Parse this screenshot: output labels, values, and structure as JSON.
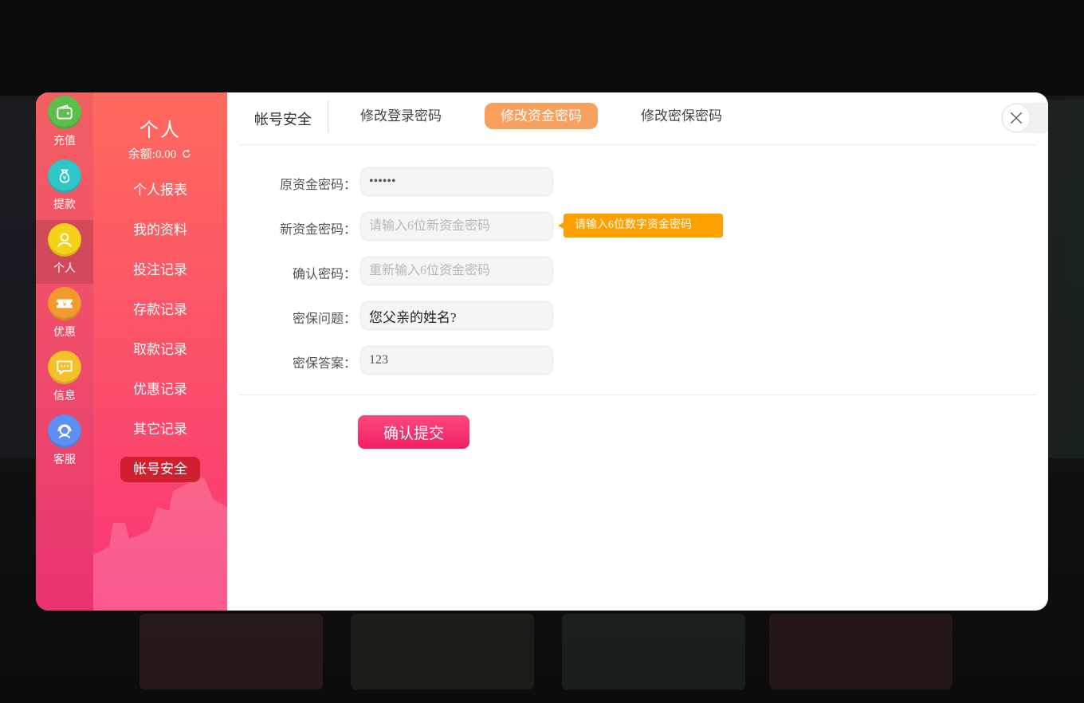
{
  "rail": {
    "items": [
      {
        "label": "充值",
        "icon": "wallet-icon",
        "color": "#5cbf4a"
      },
      {
        "label": "提款",
        "icon": "money-bag-icon",
        "color": "#2ec6c6"
      },
      {
        "label": "个人",
        "icon": "user-icon",
        "color": "#f5d21a"
      },
      {
        "label": "优惠",
        "icon": "ticket-icon",
        "color": "#f39a2e"
      },
      {
        "label": "信息",
        "icon": "message-icon",
        "color": "#f5c12a"
      },
      {
        "label": "客服",
        "icon": "headset-icon",
        "color": "#5d8ff2"
      }
    ]
  },
  "side": {
    "title": "个人",
    "balance": "余额:0.00",
    "menu": [
      "个人报表",
      "我的资料",
      "投注记录",
      "存款记录",
      "取款记录",
      "优惠记录",
      "其它记录",
      "帐号安全"
    ]
  },
  "tabs": {
    "section": "帐号安全",
    "items": [
      "修改登录密码",
      "修改资金密码",
      "修改密保密码"
    ],
    "active_index": 1
  },
  "form": {
    "old_password": {
      "label": "原资金密码：",
      "value": "••••••"
    },
    "new_password": {
      "label": "新资金密码：",
      "placeholder": "请输入6位新资金密码"
    },
    "tip": "请输入6位数字资金密码",
    "confirm_password": {
      "label": "确认密码：",
      "placeholder": "重新输入6位资金密码"
    },
    "security_question": {
      "label": "密保问题：",
      "value": "您父亲的姓名?"
    },
    "security_answer": {
      "label": "密保答案：",
      "value": "123"
    },
    "submit_label": "确认提交"
  },
  "colors": {
    "active_tab": "#f8a05e",
    "tip": "#ff9f00",
    "submit": "#f31e64",
    "active_menu": "#d01f2e"
  }
}
